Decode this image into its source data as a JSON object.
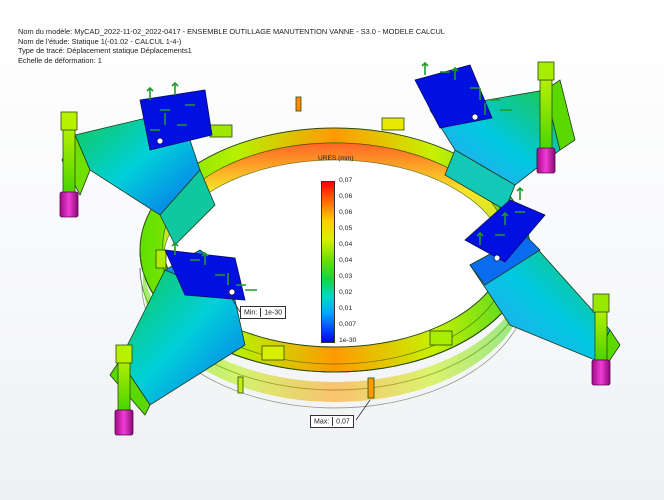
{
  "info": {
    "model_line": "Nom du modèle: MyCAD_2022-11-02_2022-0417 - ENSEMBLE OUTILLAGE MANUTENTION VANNE - S3.0 - MODELE CALCUL",
    "study_line": "Nom de l'étude: Statique 1(-01.02 - CALCUL 1-4-)",
    "plot_type_line": "Type de tracé: Déplacement statique Déplacements1",
    "scale_line": "Echelle de déformation: 1"
  },
  "legend": {
    "title": "URES (mm)",
    "ticks": [
      "0,07",
      "0,06",
      "0,06",
      "0,05",
      "0,04",
      "0,04",
      "0,03",
      "0,02",
      "0,01",
      "0,007",
      "1e-30"
    ]
  },
  "min_callout": {
    "label": "Min:",
    "value": "1e-30"
  },
  "max_callout": {
    "label": "Max:",
    "value": "0,07"
  },
  "colors": {
    "max": "#ff0000",
    "high": "#ffcc00",
    "mid": "#72e000",
    "low": "#00d8c8",
    "min": "#0000ee",
    "bolt_head": "#b0107a",
    "fixture_arrow": "#1e9a2b"
  }
}
